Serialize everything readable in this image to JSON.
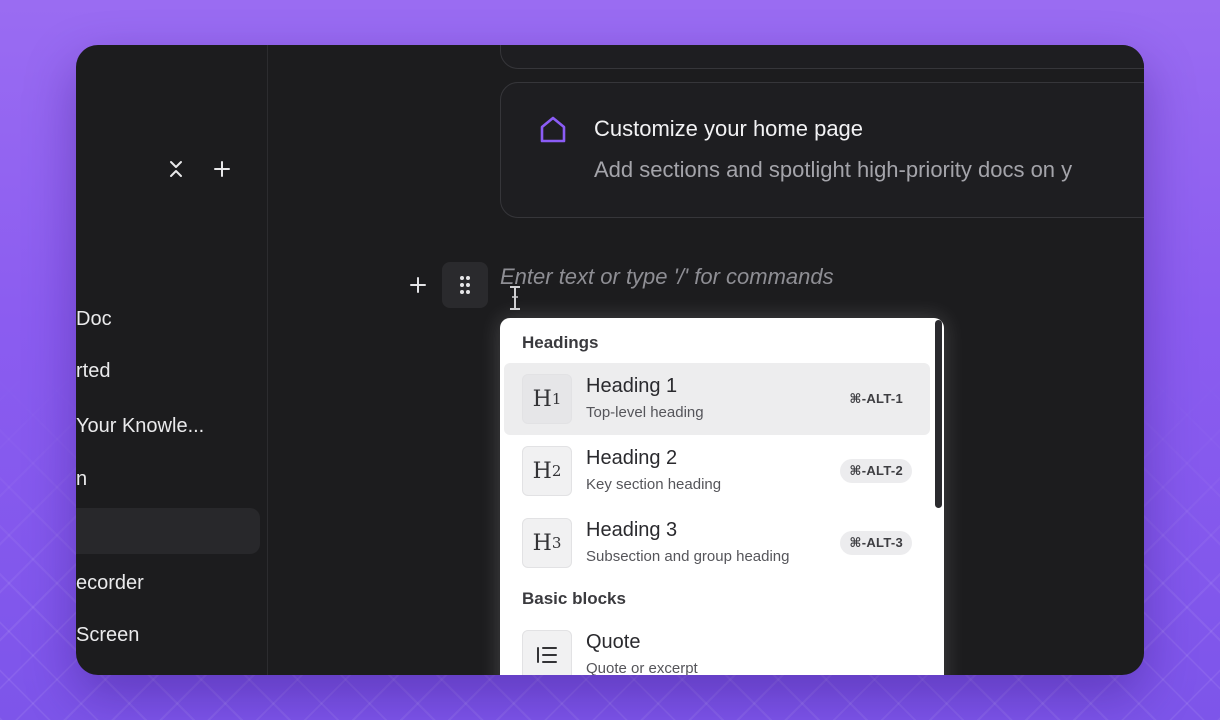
{
  "sidebar": {
    "collapse_icon": "collapse-icon",
    "add_icon": "plus-icon",
    "items": [
      {
        "label": "Doc"
      },
      {
        "label": "rted"
      },
      {
        "label": "Your Knowle..."
      },
      {
        "label": "n"
      },
      {
        "label": ""
      },
      {
        "label": "ecorder"
      },
      {
        "label": "Screen"
      }
    ]
  },
  "cards": {
    "home": {
      "icon": "house-icon",
      "title": "Customize your home page",
      "description": "Add sections and spotlight high-priority docs on y"
    }
  },
  "editor": {
    "placeholder": "Enter text or type '/' for commands",
    "add_icon": "plus-icon",
    "drag_icon": "drag-handle-icon"
  },
  "menu": {
    "sections": [
      {
        "label": "Headings",
        "items": [
          {
            "icon_letter": "H",
            "icon_num": "1",
            "title": "Heading 1",
            "description": "Top-level heading",
            "shortcut": "⌘-ALT-1"
          },
          {
            "icon_letter": "H",
            "icon_num": "2",
            "title": "Heading 2",
            "description": "Key section heading",
            "shortcut": "⌘-ALT-2"
          },
          {
            "icon_letter": "H",
            "icon_num": "3",
            "title": "Heading 3",
            "description": "Subsection and group heading",
            "shortcut": "⌘-ALT-3"
          }
        ]
      },
      {
        "label": "Basic blocks",
        "items": [
          {
            "icon": "quote-icon",
            "title": "Quote",
            "description": "Quote or excerpt"
          }
        ]
      }
    ]
  },
  "colors": {
    "accent": "#8b5cf6",
    "background_gradient_top": "#9a6cf2",
    "window": "#1c1c1e"
  }
}
